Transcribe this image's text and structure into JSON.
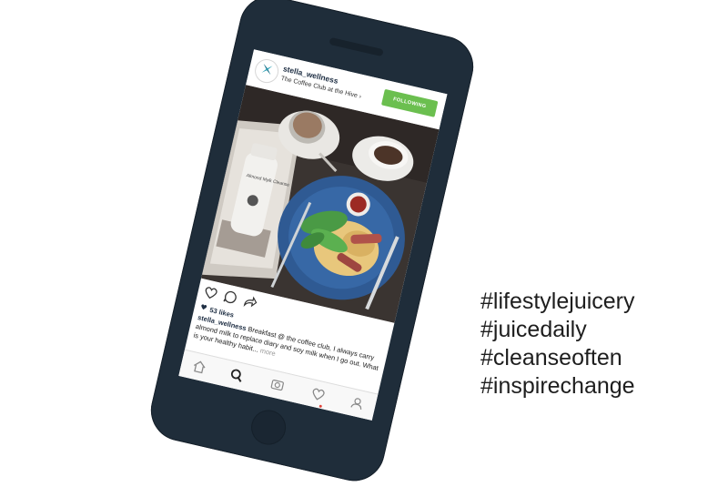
{
  "post": {
    "username": "stella_wellness",
    "location": "The Coffee Club at the Hive ›",
    "follow_label": "FOLLOWING",
    "likes": "53 likes",
    "caption_user": "stella_wellness",
    "caption_text": " Breakfast @ the coffee club, I always carry almond milk to replace diary and soy milk when I go out. What is your healthy habit...",
    "caption_more": " more"
  },
  "photo": {
    "bottle_text": "Almond Mylk Cleanse"
  },
  "icons": {
    "avatar": "logo-x-icon",
    "like": "heart-icon",
    "comment": "comment-icon",
    "share": "share-icon",
    "nav": [
      "home-icon",
      "search-icon",
      "camera-icon",
      "activity-heart-icon",
      "profile-icon"
    ]
  },
  "colors": {
    "phone_body": "#1f2d3a",
    "follow_button": "#6bbf4f",
    "username": "#1f2f44",
    "active_indicator": "#e0443a"
  },
  "hashtags": [
    "#lifestylejuicery",
    "#juicedaily",
    "#cleanseoften",
    "#inspirechange"
  ]
}
